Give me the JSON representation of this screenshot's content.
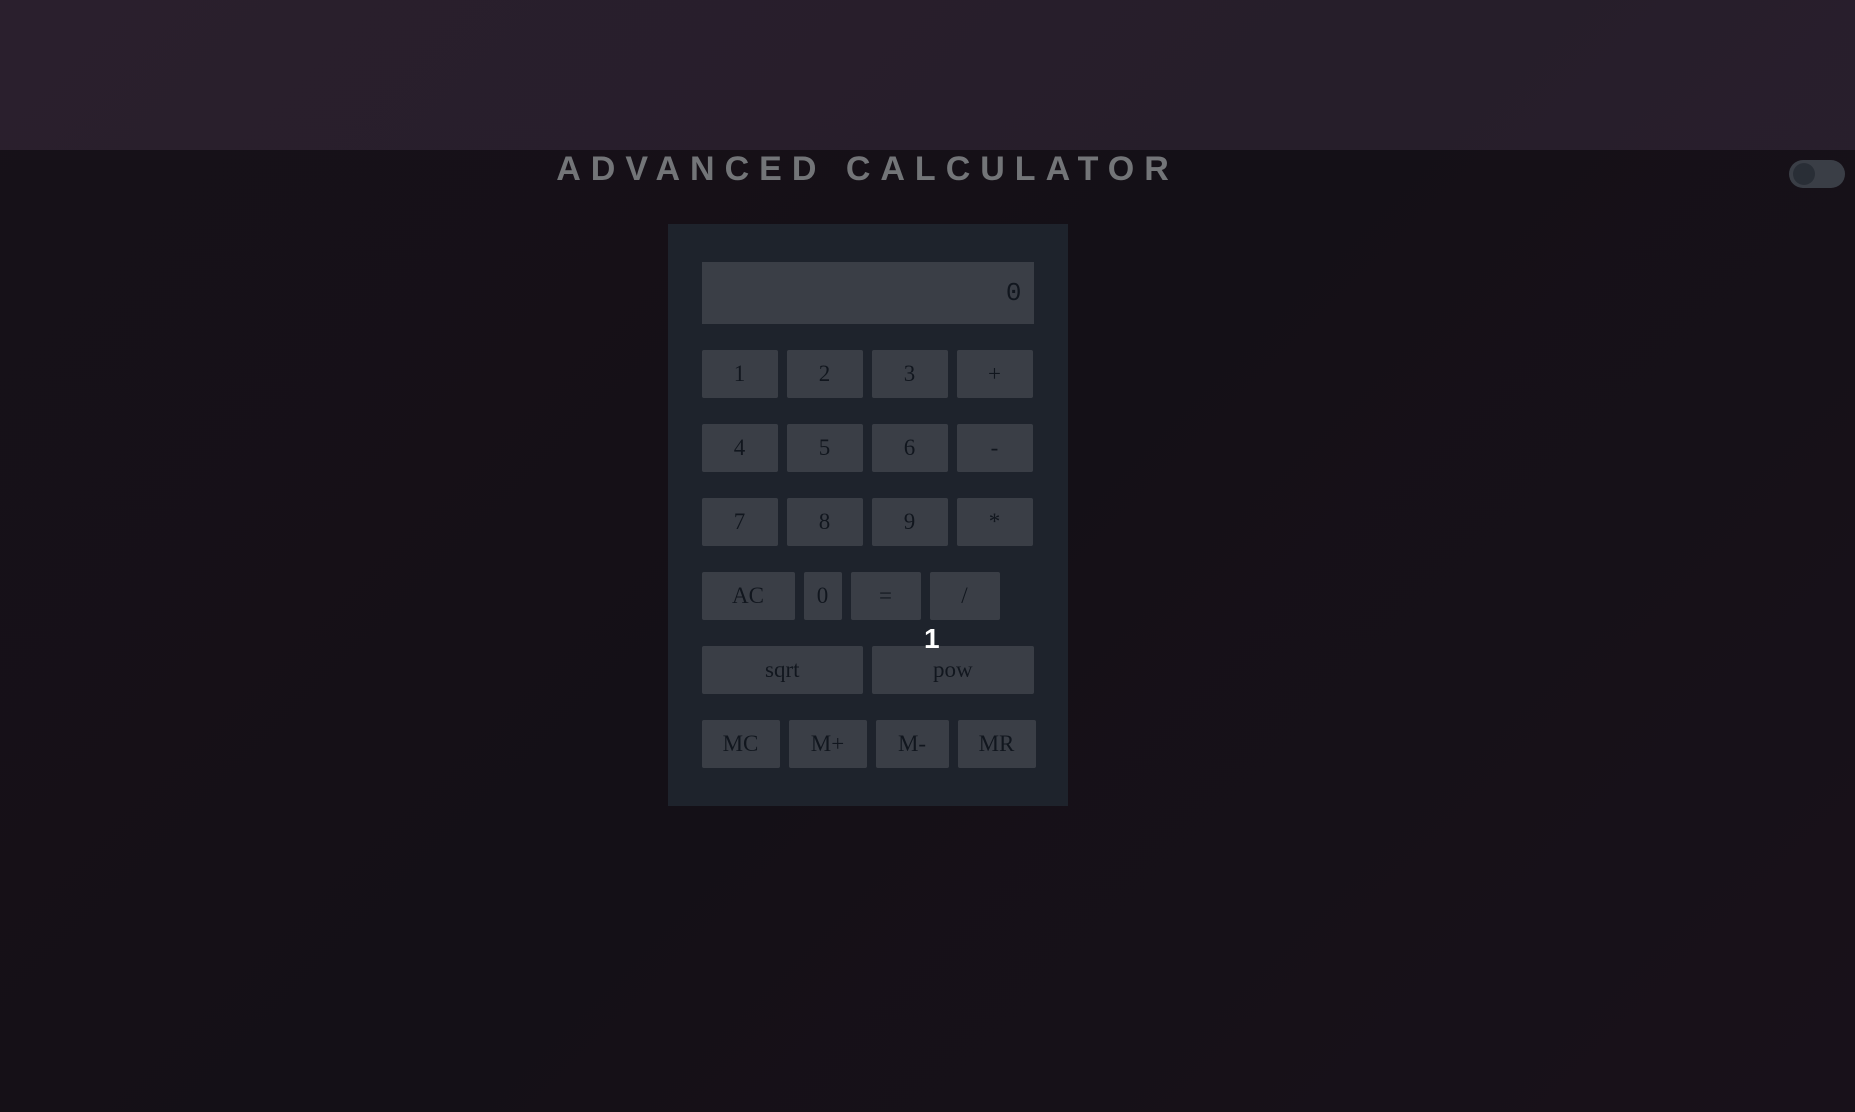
{
  "title": "ADVANCED CALCULATOR",
  "display": "0",
  "buttons": {
    "row1": [
      "1",
      "2",
      "3",
      "+"
    ],
    "row2": [
      "4",
      "5",
      "6",
      "-"
    ],
    "row3": [
      "7",
      "8",
      "9",
      "*"
    ],
    "row4": [
      "AC",
      "0",
      "=",
      "/"
    ],
    "row5": [
      "sqrt",
      "pow"
    ],
    "row6": [
      "MC",
      "M+",
      "M-",
      "MR"
    ]
  },
  "cursor_label": "1"
}
